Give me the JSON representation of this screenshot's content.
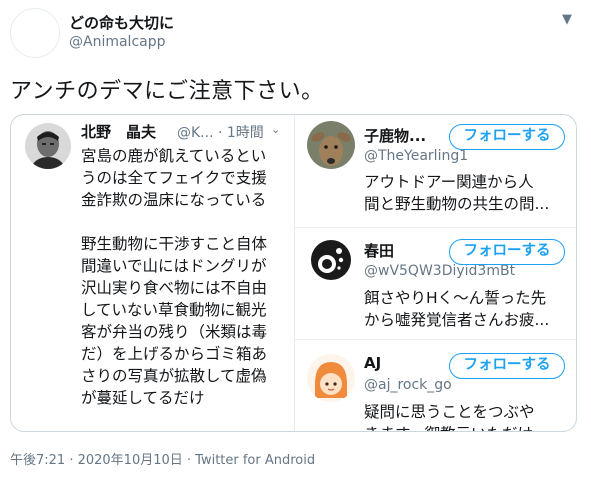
{
  "tweet": {
    "display_name": "どの命も大切に",
    "handle": "@Animalcapp",
    "text": "アンチのデマにご注意下さい。",
    "footer": "午後7:21 · 2020年10月10日 · Twitter for Android",
    "caret_icon": "chevron-down-icon"
  },
  "quoted": {
    "name": "北野　晶夫",
    "meta": "@K... · 1時間",
    "para1": [
      "宮島の鹿が飢えているとい",
      "うのは全てフェイクで支援",
      "金詐欺の温床になっている"
    ],
    "para2": [
      "野生動物に干渉すこと自体",
      "間違いで山にはドングリが",
      "沢山実り食べ物には不自由",
      "していない草食動物に観光",
      "客が弁当の残り（米類は毒",
      "だ）を上げるからゴミ箱あ",
      "さりの写真が拡散して虚偽",
      "が蔓延してるだけ"
    ]
  },
  "accounts": [
    {
      "name": "子鹿物...",
      "handle": "@TheYearling1",
      "follow_label": "フォローする",
      "bio": [
        "アウトドアー関連から人",
        "間と野生動物の共生の問..."
      ]
    },
    {
      "name": "春田",
      "handle": "@wV5QW3Diyid3mBt",
      "follow_label": "フォローする",
      "bio": [
        "餌さやりHく～ん誓った先",
        "から嘘発覚信者さんお疲..."
      ]
    },
    {
      "name": "AJ",
      "handle": "@aj_rock_go",
      "follow_label": "フォローする",
      "bio": [
        "疑問に思うことをつぶや",
        "きます。御教示いただけ"
      ]
    }
  ],
  "colors": {
    "accent": "#1da1f2",
    "text": "#14171a",
    "secondary": "#657786",
    "border": "#ccd6dd"
  }
}
